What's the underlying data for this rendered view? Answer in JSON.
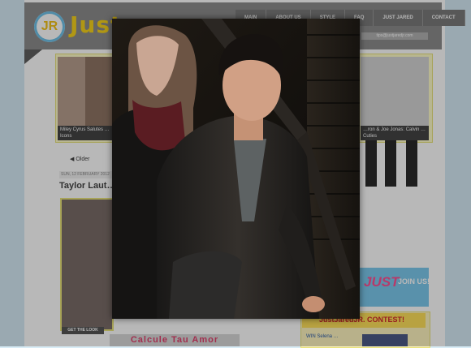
{
  "site": {
    "logo_badge": "JR",
    "logo_text": "Just",
    "nav": [
      "MAIN",
      "ABOUT US",
      "STYLE",
      "FAQ",
      "JUST JARED",
      "CONTACT"
    ],
    "email": "tips@justjaredjr.com"
  },
  "strip": {
    "caption_left": "Miley Cyrus Salutes … Icons",
    "caption_right": "…ron & Joe Jonas: Calvin … Cuties"
  },
  "post": {
    "older_label": "Older",
    "date": "SUN, 12 FEBRUARY 2012",
    "title": "Taylor Laut…",
    "get_the_look": "GET THE LOOK"
  },
  "banner": {
    "text": "Calcule Tau Amor"
  },
  "sidebar": {
    "just": "JUST",
    "join": "JOIN US!",
    "contest_title": "JustJaredJR. CONTEST!",
    "contest_small": "WIN Selena …"
  },
  "colors": {
    "header": "#8c8c8c",
    "accent_yellow": "#f6d21c",
    "accent_blue": "#7cc9ee",
    "page_bg": "#d6ebf6"
  },
  "lightbox": {
    "icon": "photo-lightbox"
  }
}
